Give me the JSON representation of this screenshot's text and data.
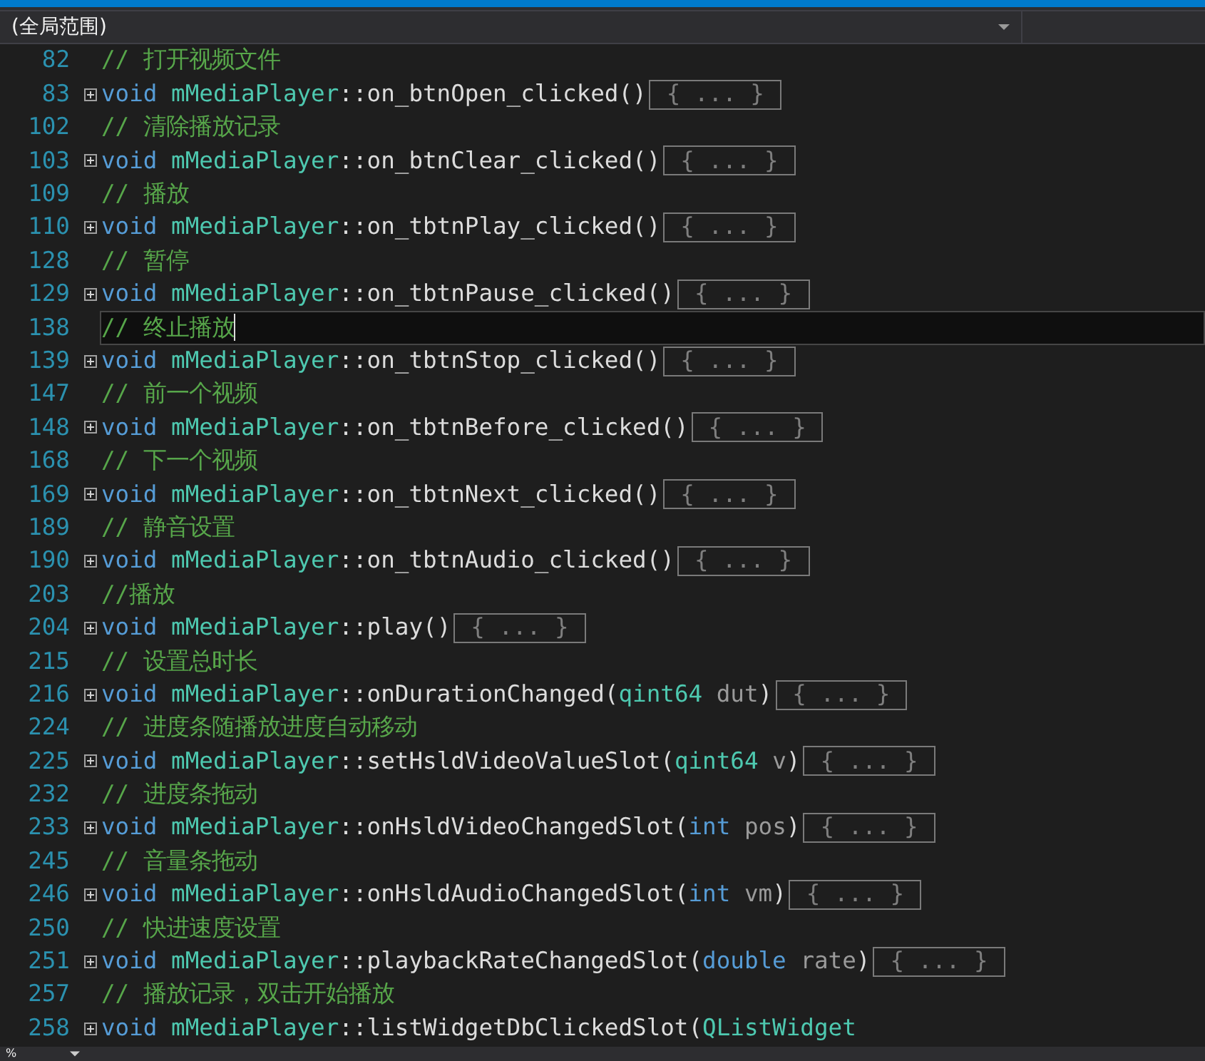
{
  "scope_bar": {
    "scope": "(全局范围)"
  },
  "editor": {
    "lines": [
      {
        "number": "82",
        "kind": "comment",
        "current": false,
        "text": "// 打开视频文件"
      },
      {
        "number": "83",
        "kind": "function",
        "current": false,
        "folded": true,
        "fold_text": "{ ... }",
        "return_type": "void",
        "class": "mMediaPlayer",
        "scope": "::",
        "name": "on_btnOpen_clicked",
        "open": "(",
        "close": ")"
      },
      {
        "number": "102",
        "kind": "comment",
        "current": false,
        "text": "// 清除播放记录"
      },
      {
        "number": "103",
        "kind": "function",
        "current": false,
        "folded": true,
        "fold_text": "{ ... }",
        "return_type": "void",
        "class": "mMediaPlayer",
        "scope": "::",
        "name": "on_btnClear_clicked",
        "open": "(",
        "close": ")"
      },
      {
        "number": "109",
        "kind": "comment",
        "current": false,
        "text": "// 播放"
      },
      {
        "number": "110",
        "kind": "function",
        "current": false,
        "folded": true,
        "fold_text": "{ ... }",
        "return_type": "void",
        "class": "mMediaPlayer",
        "scope": "::",
        "name": "on_tbtnPlay_clicked",
        "open": "(",
        "close": ")"
      },
      {
        "number": "128",
        "kind": "comment",
        "current": false,
        "text": "// 暂停"
      },
      {
        "number": "129",
        "kind": "function",
        "current": false,
        "folded": true,
        "fold_text": "{ ... }",
        "return_type": "void",
        "class": "mMediaPlayer",
        "scope": "::",
        "name": "on_tbtnPause_clicked",
        "open": "(",
        "close": ")"
      },
      {
        "number": "138",
        "kind": "comment",
        "current": true,
        "text": "// 终止播放"
      },
      {
        "number": "139",
        "kind": "function",
        "current": false,
        "folded": true,
        "fold_text": "{ ... }",
        "return_type": "void",
        "class": "mMediaPlayer",
        "scope": "::",
        "name": "on_tbtnStop_clicked",
        "open": "(",
        "close": ")"
      },
      {
        "number": "147",
        "kind": "comment",
        "current": false,
        "text": "// 前一个视频"
      },
      {
        "number": "148",
        "kind": "function",
        "current": false,
        "folded": true,
        "fold_text": "{ ... }",
        "return_type": "void",
        "class": "mMediaPlayer",
        "scope": "::",
        "name": "on_tbtnBefore_clicked",
        "open": "(",
        "close": ")"
      },
      {
        "number": "168",
        "kind": "comment",
        "current": false,
        "text": "// 下一个视频"
      },
      {
        "number": "169",
        "kind": "function",
        "current": false,
        "folded": true,
        "fold_text": "{ ... }",
        "return_type": "void",
        "class": "mMediaPlayer",
        "scope": "::",
        "name": "on_tbtnNext_clicked",
        "open": "(",
        "close": ")"
      },
      {
        "number": "189",
        "kind": "comment",
        "current": false,
        "text": "// 静音设置"
      },
      {
        "number": "190",
        "kind": "function",
        "current": false,
        "folded": true,
        "fold_text": "{ ... }",
        "return_type": "void",
        "class": "mMediaPlayer",
        "scope": "::",
        "name": "on_tbtnAudio_clicked",
        "open": "(",
        "close": ")"
      },
      {
        "number": "203",
        "kind": "comment",
        "current": false,
        "text": "//播放"
      },
      {
        "number": "204",
        "kind": "function",
        "current": false,
        "folded": true,
        "fold_text": "{ ... }",
        "return_type": "void",
        "class": "mMediaPlayer",
        "scope": "::",
        "name": "play",
        "open": "(",
        "close": ")"
      },
      {
        "number": "215",
        "kind": "comment",
        "current": false,
        "text": "// 设置总时长"
      },
      {
        "number": "216",
        "kind": "function",
        "current": false,
        "folded": true,
        "fold_text": "{ ... }",
        "return_type": "void",
        "class": "mMediaPlayer",
        "scope": "::",
        "name": "onDurationChanged",
        "open": "(",
        "params": [
          {
            "kind": "class",
            "type": "qint64",
            "name": "dut"
          }
        ],
        "close": ")"
      },
      {
        "number": "224",
        "kind": "comment",
        "current": false,
        "text": "// 进度条随播放进度自动移动"
      },
      {
        "number": "225",
        "kind": "function",
        "current": false,
        "folded": true,
        "fold_text": "{ ... }",
        "return_type": "void",
        "class": "mMediaPlayer",
        "scope": "::",
        "name": "setHsldVideoValueSlot",
        "open": "(",
        "params": [
          {
            "kind": "class",
            "type": "qint64",
            "name": "v"
          }
        ],
        "close": ")"
      },
      {
        "number": "232",
        "kind": "comment",
        "current": false,
        "text": "// 进度条拖动"
      },
      {
        "number": "233",
        "kind": "function",
        "current": false,
        "folded": true,
        "fold_text": "{ ... }",
        "return_type": "void",
        "class": "mMediaPlayer",
        "scope": "::",
        "name": "onHsldVideoChangedSlot",
        "open": "(",
        "params": [
          {
            "kind": "builtin",
            "type": "int",
            "name": "pos"
          }
        ],
        "close": ")"
      },
      {
        "number": "245",
        "kind": "comment",
        "current": false,
        "text": "// 音量条拖动"
      },
      {
        "number": "246",
        "kind": "function",
        "current": false,
        "folded": true,
        "fold_text": "{ ... }",
        "return_type": "void",
        "class": "mMediaPlayer",
        "scope": "::",
        "name": "onHsldAudioChangedSlot",
        "open": "(",
        "params": [
          {
            "kind": "builtin",
            "type": "int",
            "name": "vm"
          }
        ],
        "close": ")"
      },
      {
        "number": "250",
        "kind": "comment",
        "current": false,
        "text": "// 快进速度设置"
      },
      {
        "number": "251",
        "kind": "function",
        "current": false,
        "folded": true,
        "fold_text": "{ ... }",
        "return_type": "void",
        "class": "mMediaPlayer",
        "scope": "::",
        "name": "playbackRateChangedSlot",
        "open": "(",
        "params": [
          {
            "kind": "builtin",
            "type": "double",
            "name": "rate"
          }
        ],
        "close": ")"
      },
      {
        "number": "257",
        "kind": "comment",
        "current": false,
        "text": "// 播放记录，双击开始播放"
      },
      {
        "number": "258",
        "kind": "function",
        "current": false,
        "folded": true,
        "return_type": "void",
        "class": "mMediaPlayer",
        "scope": "::",
        "name": "listWidgetDbClickedSlot",
        "open": "(",
        "params": [
          {
            "kind": "class",
            "type": "QListWidget"
          }
        ]
      }
    ]
  },
  "status_bar": {
    "zoom": "%"
  }
}
